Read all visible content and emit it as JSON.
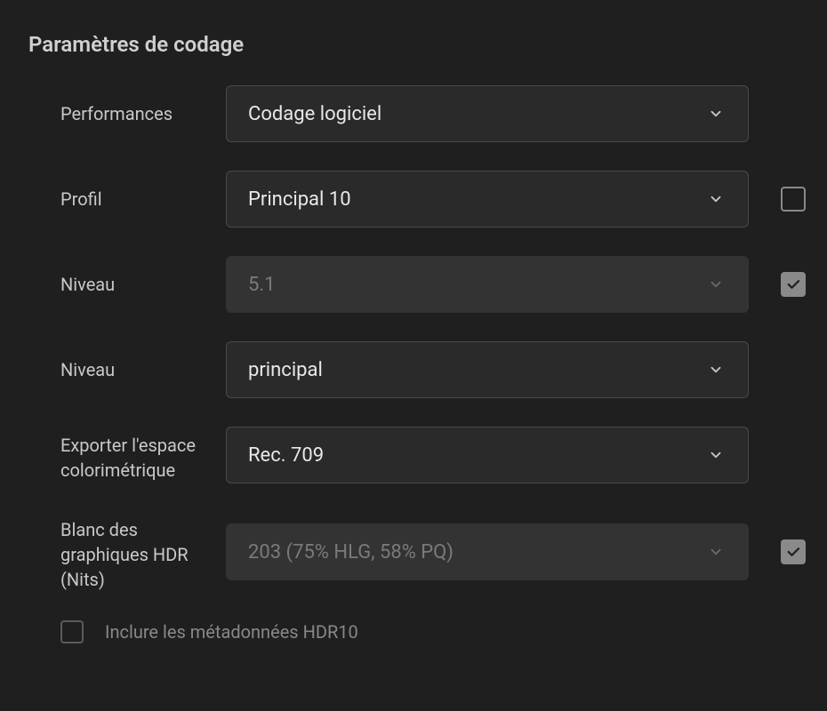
{
  "section": {
    "title": "Paramètres de codage"
  },
  "rows": {
    "performances": {
      "label": "Performances",
      "value": "Codage logiciel"
    },
    "profil": {
      "label": "Profil",
      "value": "Principal 10",
      "checked": false
    },
    "niveau1": {
      "label": "Niveau",
      "value": "5.1",
      "checked": true
    },
    "niveau2": {
      "label": "Niveau",
      "value": "principal"
    },
    "colorspace": {
      "label": "Exporter l'espace colorimétrique",
      "value": "Rec. 709"
    },
    "hdrwhite": {
      "label": "Blanc des graphiques HDR (Nits)",
      "value": "203 (75% HLG, 58% PQ)",
      "checked": true
    }
  },
  "footer": {
    "includeHdr10": {
      "label": "Inclure les métadonnées HDR10",
      "checked": false
    }
  }
}
